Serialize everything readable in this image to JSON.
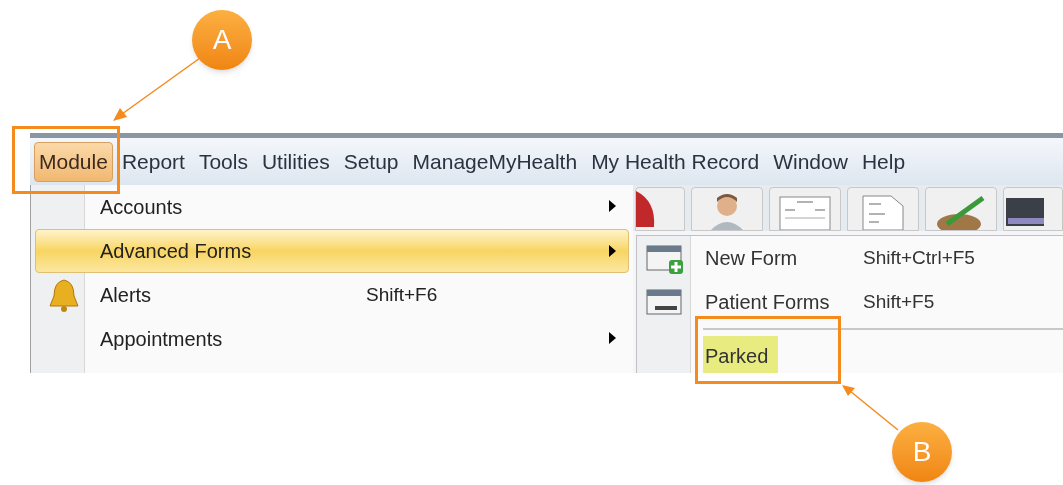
{
  "menu_bar": [
    {
      "label": "Module",
      "selected": true
    },
    {
      "label": "Report",
      "selected": false
    },
    {
      "label": "Tools",
      "selected": false
    },
    {
      "label": "Utilities",
      "selected": false
    },
    {
      "label": "Setup",
      "selected": false
    },
    {
      "label": "ManageMyHealth",
      "selected": false
    },
    {
      "label": "My Health Record",
      "selected": false
    },
    {
      "label": "Window",
      "selected": false
    },
    {
      "label": "Help",
      "selected": false
    }
  ],
  "module_menu": [
    {
      "label": "Accounts",
      "has_submenu": true,
      "has_icon": false,
      "selected": false
    },
    {
      "label": "Advanced Forms",
      "has_submenu": true,
      "has_icon": false,
      "selected": true
    },
    {
      "label": "Alerts",
      "shortcut": "Shift+F6",
      "has_submenu": false,
      "has_icon": true,
      "selected": false
    },
    {
      "label": "Appointments",
      "has_submenu": true,
      "has_icon": false,
      "selected": false
    }
  ],
  "advanced_forms_menu": [
    {
      "kind": "item",
      "label": "New Form",
      "shortcut": "Shift+Ctrl+F5",
      "has_icon": true,
      "selected": false
    },
    {
      "kind": "item",
      "label": "Patient Forms",
      "shortcut": "Shift+F5",
      "has_icon": true,
      "selected": false
    },
    {
      "kind": "separator"
    },
    {
      "kind": "item",
      "label": "Parked",
      "has_icon": false,
      "selected": true
    }
  ],
  "callouts": [
    {
      "label": "A"
    },
    {
      "label": "B"
    }
  ]
}
